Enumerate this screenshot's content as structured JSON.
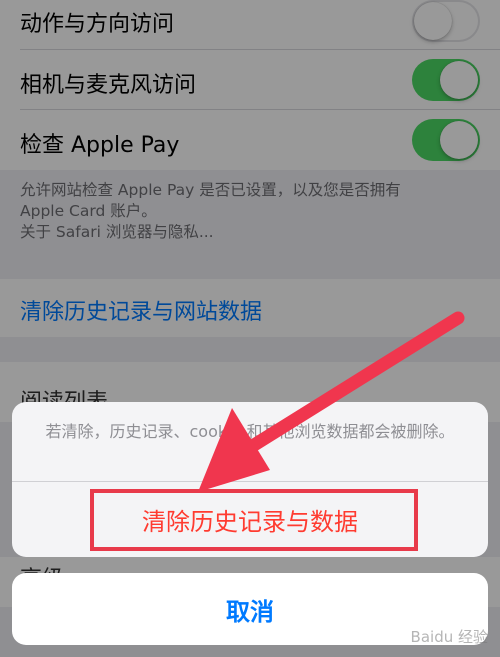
{
  "settings": {
    "rows": [
      {
        "label": "动作与方向访问",
        "toggle": "off"
      },
      {
        "label": "相机与麦克风访问",
        "toggle": "on"
      },
      {
        "label": "检查 Apple Pay",
        "toggle": "on"
      }
    ],
    "footnote_line1": "允许网站检查 Apple Pay 是否已设置，以及您是否拥有",
    "footnote_line2": "Apple Card 账户。",
    "footnote_link": "关于 Safari 浏览器与隐私...",
    "clear_history_link": "清除历史记录与网站数据",
    "partial_row_reading_list": "阅读列表",
    "partial_row_advanced": "高级"
  },
  "action_sheet": {
    "message": "若清除，历史记录、cookie 和其他浏览数据都会被删除。",
    "destructive_label": "清除历史记录与数据",
    "cancel_label": "取消"
  },
  "colors": {
    "toggle_on": "#4bd964",
    "link_blue": "#007aff",
    "destructive_red": "#ff3b30",
    "annotation_red": "#e83a4a"
  },
  "watermark": "Baidu 经验"
}
